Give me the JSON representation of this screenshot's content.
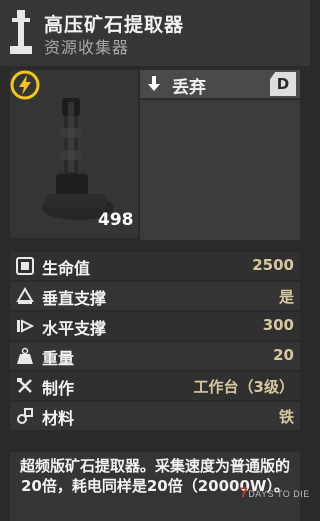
{
  "header": {
    "title": "高压矿石提取器",
    "subtitle": "资源收集器",
    "icon": "extractor-icon"
  },
  "preview": {
    "power_value": "498",
    "power_icon": "lightning-icon"
  },
  "actions": {
    "drop_label": "丢弃",
    "drop_key": "D",
    "drop_icon": "arrow-down-icon"
  },
  "stats": [
    {
      "icon": "health-icon",
      "label": "生命值",
      "value": "2500"
    },
    {
      "icon": "vertical-support-icon",
      "label": "垂直支撑",
      "value": "是"
    },
    {
      "icon": "horizontal-support-icon",
      "label": "水平支撑",
      "value": "300"
    },
    {
      "icon": "weight-icon",
      "label": "重量",
      "value": "20"
    },
    {
      "icon": "crafting-icon",
      "label": "制作",
      "value": "工作台（3级）"
    },
    {
      "icon": "material-icon",
      "label": "材料",
      "value": "铁"
    }
  ],
  "description": "超频版矿石提取器。采集速度为普通版的20倍，耗电同样是20倍（20000W）。",
  "watermark": "7DAYS TO DIE",
  "colors": {
    "background": "#2a2a2a",
    "stat_value": "#d7c8a0",
    "power_badge": "#f5c518"
  }
}
